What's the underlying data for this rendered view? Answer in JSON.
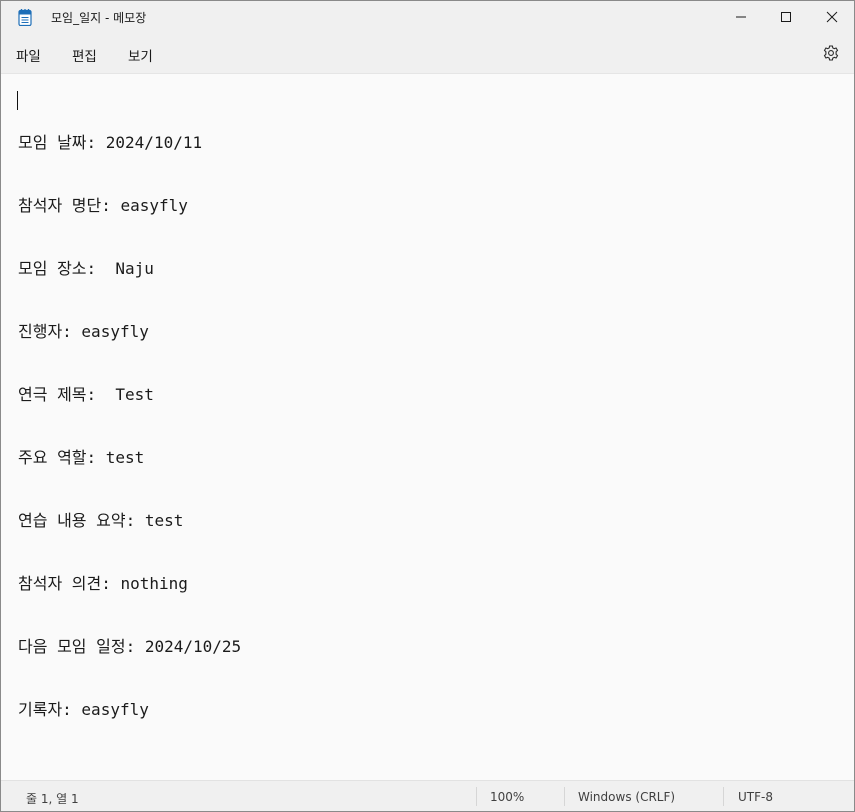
{
  "window": {
    "title": "모임_일지 - 메모장",
    "app_icon": "notepad-icon",
    "controls": [
      "minimize-icon",
      "maximize-icon",
      "close-icon"
    ]
  },
  "menu": {
    "file": "파일",
    "edit": "편집",
    "view": "보기",
    "settings_icon": "gear-icon"
  },
  "editor": {
    "lines": [
      "모임 날짜: 2024/10/11",
      "참석자 명단: easyfly",
      "모임 장소:  Naju",
      "진행자: easyfly",
      "연극 제목:  Test",
      "주요 역할: test",
      "연습 내용 요약: test",
      "참석자 의견: nothing",
      "다음 모임 일정: 2024/10/25",
      "기록자: easyfly"
    ]
  },
  "status": {
    "position": "줄 1, 열 1",
    "zoom": "100%",
    "line_ending": "Windows (CRLF)",
    "encoding": "UTF-8"
  },
  "colors": {
    "accent": "#1e6fb8",
    "background": "#f9f9f9",
    "chrome": "#f0f0f0"
  }
}
